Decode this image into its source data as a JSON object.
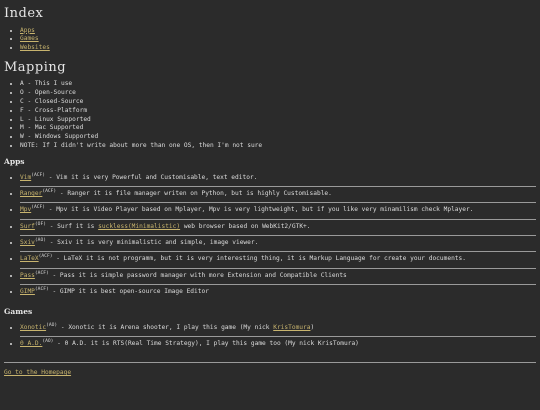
{
  "index": {
    "title": "Index",
    "links": [
      "Apps",
      "Games",
      "Websites"
    ]
  },
  "mapping": {
    "title": "Mapping",
    "items": [
      "A - This I use",
      "O - Open-Source",
      "C - Closed-Source",
      "F - Cross-Platform",
      "L - Linux Supported",
      "M - Mac Supported",
      "W - Windows Supported",
      "NOTE: If I didn't write about more than one OS, then I'm not sure"
    ]
  },
  "apps": {
    "title": "Apps",
    "items": [
      {
        "name": "Vim",
        "tags": "(ACF)",
        "desc": " - Vim it is very Powerful and Customisable, text editor."
      },
      {
        "name": "Ranger",
        "tags": "(ACF)",
        "desc": " - Ranger it is file manager writen on Python, but is highly Customisable."
      },
      {
        "name": "Mpv",
        "tags": "(ACF)",
        "desc": " - Mpv it is Video Player based on Mplayer, Mpv is very lightweight, but if you like very minamilism check Mplayer."
      },
      {
        "name": "Surf",
        "tags": "(OF)",
        "desc_pre": " - Surf it is ",
        "link": "suckless(Minimalistic)",
        "desc_post": " web browser based on WebKit2/GTK+."
      },
      {
        "name": "Sxiv",
        "tags": "(AO)",
        "desc": " - Sxiv it is very minimalistic and simple, image viewer."
      },
      {
        "name": "LaTeX",
        "tags": "(ACF)",
        "desc": " - LaTeX it is not programm, but it is very interesting thing, it is Markup Language for create your documents."
      },
      {
        "name": "Pass",
        "tags": "(ACF)",
        "desc": " - Pass it is simple password manager with more Extension and Compatible Clients"
      },
      {
        "name": "GIMP",
        "tags": "(ACF)",
        "desc": " - GIMP it is best open-source Image Editor"
      }
    ]
  },
  "games": {
    "title": "Games",
    "items": [
      {
        "name": "Xonotic",
        "tags": "(AO)",
        "desc": " - Xonotic it is Arena shooter, I play this game (My nick ",
        "nick": "KrisTomura",
        "nick_linked": true,
        "end": ")"
      },
      {
        "name": "0 A.D.",
        "tags": "(AO)",
        "desc": " - 0 A.D. it is RTS(Real Time Strategy), I play this game too (My nick KrisTomura)",
        "nick_linked": false
      }
    ]
  },
  "footer": {
    "home_link": "Go to the Homepage"
  }
}
